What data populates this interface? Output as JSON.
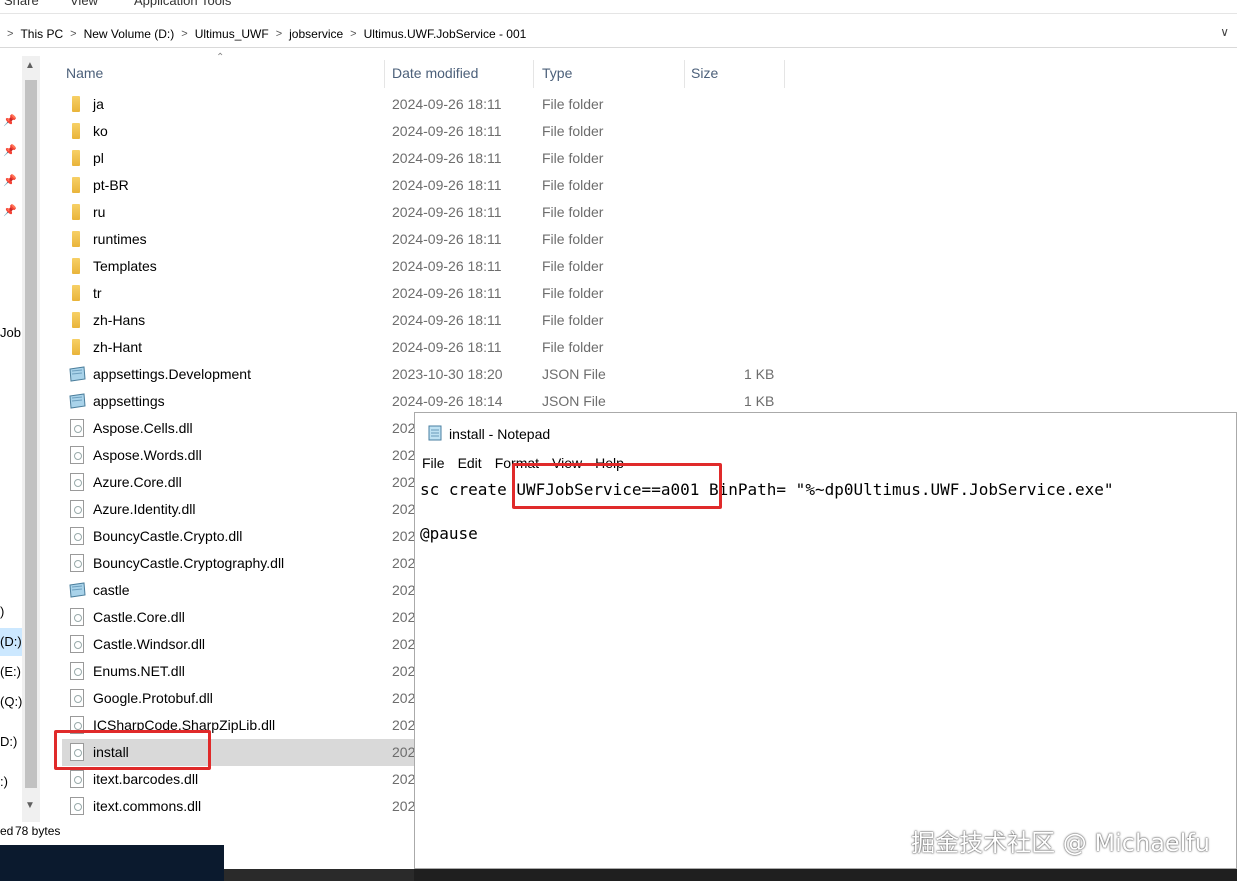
{
  "ribbon": {
    "tabs": [
      "Share",
      "View",
      "Application Tools"
    ]
  },
  "address": {
    "crumbs": [
      "This PC",
      "New Volume (D:)",
      "Ultimus_UWF",
      "jobservice",
      "Ultimus.UWF.JobService - 001"
    ]
  },
  "nav": {
    "partial_items": [
      "Job",
      ")",
      "(D:)",
      "(E:)",
      "(Q:)",
      "D:)",
      ":)"
    ]
  },
  "columns": {
    "name": "Name",
    "date": "Date modified",
    "type": "Type",
    "size": "Size"
  },
  "files": [
    {
      "name": "ja",
      "date": "2024-09-26 18:11",
      "type": "File folder",
      "size": "",
      "kind": "folder"
    },
    {
      "name": "ko",
      "date": "2024-09-26 18:11",
      "type": "File folder",
      "size": "",
      "kind": "folder"
    },
    {
      "name": "pl",
      "date": "2024-09-26 18:11",
      "type": "File folder",
      "size": "",
      "kind": "folder"
    },
    {
      "name": "pt-BR",
      "date": "2024-09-26 18:11",
      "type": "File folder",
      "size": "",
      "kind": "folder"
    },
    {
      "name": "ru",
      "date": "2024-09-26 18:11",
      "type": "File folder",
      "size": "",
      "kind": "folder"
    },
    {
      "name": "runtimes",
      "date": "2024-09-26 18:11",
      "type": "File folder",
      "size": "",
      "kind": "folder"
    },
    {
      "name": "Templates",
      "date": "2024-09-26 18:11",
      "type": "File folder",
      "size": "",
      "kind": "folder"
    },
    {
      "name": "tr",
      "date": "2024-09-26 18:11",
      "type": "File folder",
      "size": "",
      "kind": "folder"
    },
    {
      "name": "zh-Hans",
      "date": "2024-09-26 18:11",
      "type": "File folder",
      "size": "",
      "kind": "folder"
    },
    {
      "name": "zh-Hant",
      "date": "2024-09-26 18:11",
      "type": "File folder",
      "size": "",
      "kind": "folder"
    },
    {
      "name": "appsettings.Development",
      "date": "2023-10-30 18:20",
      "type": "JSON File",
      "size": "1 KB",
      "kind": "json"
    },
    {
      "name": "appsettings",
      "date": "2024-09-26 18:14",
      "type": "JSON File",
      "size": "1 KB",
      "kind": "json"
    },
    {
      "name": "Aspose.Cells.dll",
      "date": "202",
      "type": "",
      "size": "",
      "kind": "dll"
    },
    {
      "name": "Aspose.Words.dll",
      "date": "202",
      "type": "",
      "size": "",
      "kind": "dll"
    },
    {
      "name": "Azure.Core.dll",
      "date": "202",
      "type": "",
      "size": "",
      "kind": "dll"
    },
    {
      "name": "Azure.Identity.dll",
      "date": "202",
      "type": "",
      "size": "",
      "kind": "dll"
    },
    {
      "name": "BouncyCastle.Crypto.dll",
      "date": "202",
      "type": "",
      "size": "",
      "kind": "dll"
    },
    {
      "name": "BouncyCastle.Cryptography.dll",
      "date": "202",
      "type": "",
      "size": "",
      "kind": "dll"
    },
    {
      "name": "castle",
      "date": "202",
      "type": "",
      "size": "",
      "kind": "json"
    },
    {
      "name": "Castle.Core.dll",
      "date": "202",
      "type": "",
      "size": "",
      "kind": "dll"
    },
    {
      "name": "Castle.Windsor.dll",
      "date": "202",
      "type": "",
      "size": "",
      "kind": "dll"
    },
    {
      "name": "Enums.NET.dll",
      "date": "202",
      "type": "",
      "size": "",
      "kind": "dll"
    },
    {
      "name": "Google.Protobuf.dll",
      "date": "202",
      "type": "",
      "size": "",
      "kind": "dll"
    },
    {
      "name": "ICSharpCode.SharpZipLib.dll",
      "date": "202",
      "type": "",
      "size": "",
      "kind": "dll"
    },
    {
      "name": "install",
      "date": "202",
      "type": "",
      "size": "",
      "kind": "bat",
      "selected": true
    },
    {
      "name": "itext.barcodes.dll",
      "date": "202",
      "type": "",
      "size": "",
      "kind": "dll"
    },
    {
      "name": "itext.commons.dll",
      "date": "202",
      "type": "",
      "size": "",
      "kind": "dll"
    }
  ],
  "status": {
    "left": "ed",
    "size": "78 bytes"
  },
  "notepad": {
    "title": "install - Notepad",
    "menu": [
      "File",
      "Edit",
      "Format",
      "View",
      "Help"
    ],
    "line1": "sc create UWFJobService==a001 BinPath= \"%~dp0Ultimus.UWF.JobService.exe\"",
    "line2": "",
    "line3": "@pause"
  },
  "watermark": "掘金技术社区 @ Michaelfu",
  "colors": {
    "annotation": "#e02a2a",
    "selection": "#d9d9d9",
    "folder": "#e9b43a"
  }
}
